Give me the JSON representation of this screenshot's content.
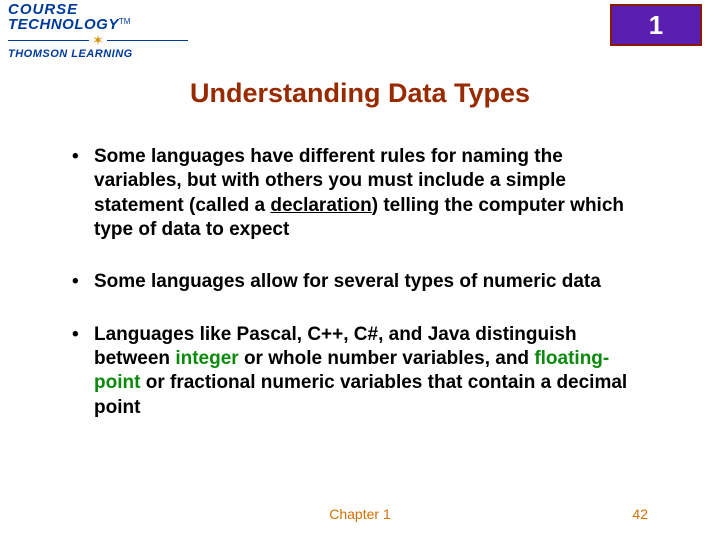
{
  "logo": {
    "line1": "COURSE",
    "line2": "TECHNOLOGY",
    "tm": "TM",
    "line3": "THOMSON LEARNING"
  },
  "badge": {
    "number": "1"
  },
  "title": "Understanding Data Types",
  "bullets": {
    "b1": {
      "p1": "Some languages have different rules for naming the variables, but with others you must include a simple statement (called a ",
      "kw": "declaration",
      "p2": ") telling the computer which type of data to expect"
    },
    "b2": {
      "p1": "Some languages allow for several types of numeric data"
    },
    "b3": {
      "p1": "Languages like Pascal, C++, C#, and Java distinguish between ",
      "kw1": "integer",
      "p2": " or whole number variables, and ",
      "kw2": "floating-point",
      "p3": " or fractional numeric variables that contain a decimal point"
    }
  },
  "footer": {
    "chapter": "Chapter 1",
    "page": "42"
  }
}
